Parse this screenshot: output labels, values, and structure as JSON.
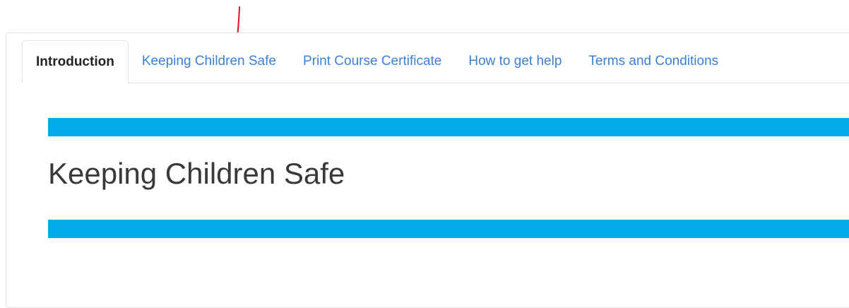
{
  "tabs": [
    {
      "label": "Introduction",
      "active": true
    },
    {
      "label": "Keeping Children Safe",
      "active": false
    },
    {
      "label": "Print Course Certificate",
      "active": false
    },
    {
      "label": "How to get help",
      "active": false
    },
    {
      "label": "Terms and Conditions",
      "active": false
    }
  ],
  "content": {
    "heading": "Keeping Children Safe"
  },
  "colors": {
    "banner": "#00aaeb",
    "link": "#3b7fd6",
    "annotation": "#e0141e"
  },
  "annotation": {
    "icon": "red-arrow-down-icon"
  }
}
